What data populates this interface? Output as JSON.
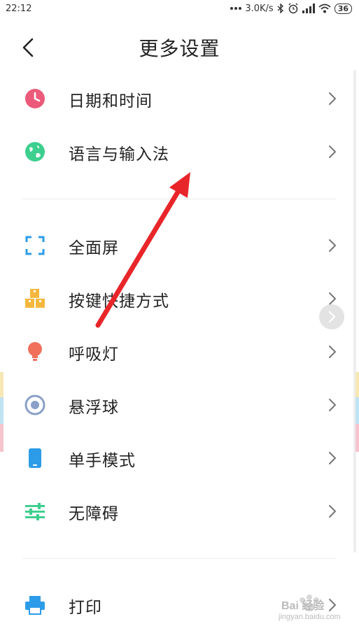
{
  "status_bar": {
    "time": "22:12",
    "net_speed": "3.0K/s",
    "battery": "36",
    "icons": [
      "more-dots-icon",
      "bluetooth-icon",
      "alarm-icon",
      "signal-icon",
      "wifi-icon",
      "battery-icon"
    ]
  },
  "header": {
    "title": "更多设置",
    "back_icon": "back-arrow-icon"
  },
  "groups": [
    {
      "items": [
        {
          "label": "日期和时间",
          "icon": "clock-icon",
          "color": "#EB5A7A"
        },
        {
          "label": "语言与输入法",
          "icon": "globe-icon",
          "color": "#3ECF8E"
        }
      ]
    },
    {
      "items": [
        {
          "label": "全面屏",
          "icon": "fullscreen-icon",
          "color": "#2D9CE8"
        },
        {
          "label": "按键快捷方式",
          "icon": "keys-icon",
          "color": "#F5B83D"
        },
        {
          "label": "呼吸灯",
          "icon": "bulb-icon",
          "color": "#F0705A"
        },
        {
          "label": "悬浮球",
          "icon": "floating-ball-icon",
          "color": "#8AA0C8"
        },
        {
          "label": "单手模式",
          "icon": "phone-icon",
          "color": "#2D9CE8"
        },
        {
          "label": "无障碍",
          "icon": "sliders-icon",
          "color": "#3ECF8E"
        }
      ]
    },
    {
      "items": [
        {
          "label": "打印",
          "icon": "printer-icon",
          "color": "#2D9CE8"
        }
      ]
    }
  ],
  "overlay": {
    "annotation_arrow_color": "#E8262A"
  },
  "watermark": {
    "text": "Bai 经验",
    "url": "jingyan.baidu.com"
  }
}
